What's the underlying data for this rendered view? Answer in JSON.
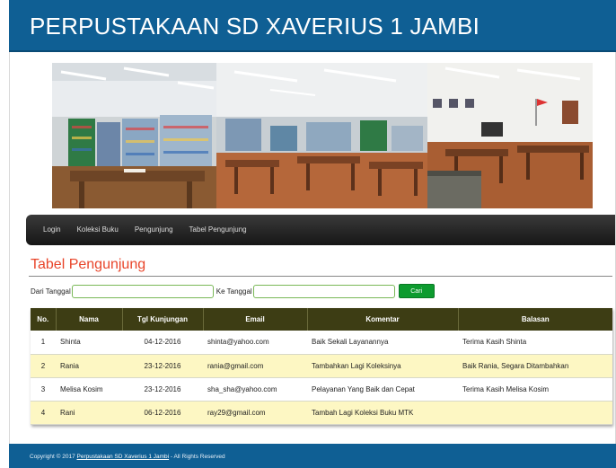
{
  "header": {
    "title": "PERPUSTAKAAN SD XAVERIUS 1 JAMBI"
  },
  "nav": {
    "items": [
      {
        "label": "Login"
      },
      {
        "label": "Koleksi Buku"
      },
      {
        "label": "Pengunjung"
      },
      {
        "label": "Tabel Pengunjung"
      }
    ]
  },
  "main": {
    "title": "Tabel Pengunjung",
    "filter": {
      "from_label": "Dari Tanggal",
      "from_value": "",
      "to_label": "Ke Tanggal",
      "to_value": "",
      "search_label": "Cari"
    },
    "table": {
      "headers": [
        "No.",
        "Nama",
        "Tgl Kunjungan",
        "Email",
        "Komentar",
        "Balasan"
      ],
      "rows": [
        [
          "1",
          "Shinta",
          "04-12-2016",
          "shinta@yahoo.com",
          "Baik Sekali Layanannya",
          "Terima Kasih Shinta"
        ],
        [
          "2",
          "Rania",
          "23-12-2016",
          "rania@gmail.com",
          "Tambahkan Lagi Koleksinya",
          "Baik Rania, Segara Ditambahkan"
        ],
        [
          "3",
          "Melisa Kosim",
          "23-12-2016",
          "sha_sha@yahoo.com",
          "Pelayanan Yang Baik dan Cepat",
          "Terima Kasih Melisa Kosim"
        ],
        [
          "4",
          "Rani",
          "06-12-2016",
          "ray29@gmail.com",
          "Tambah Lagi Koleksi Buku MTK",
          ""
        ]
      ]
    }
  },
  "footer": {
    "prefix": "Copyright © 2017 ",
    "link": "Perpustakaan SD Xaverius 1 Jambi",
    "suffix": " - All Rights Reserved"
  },
  "colors": {
    "header_bg": "#0f5f94",
    "title_accent": "#e8452a",
    "table_header_bg": "#3d3d14",
    "row_alt_bg": "#fdf7c3",
    "button_bg": "#0d9b2f"
  }
}
